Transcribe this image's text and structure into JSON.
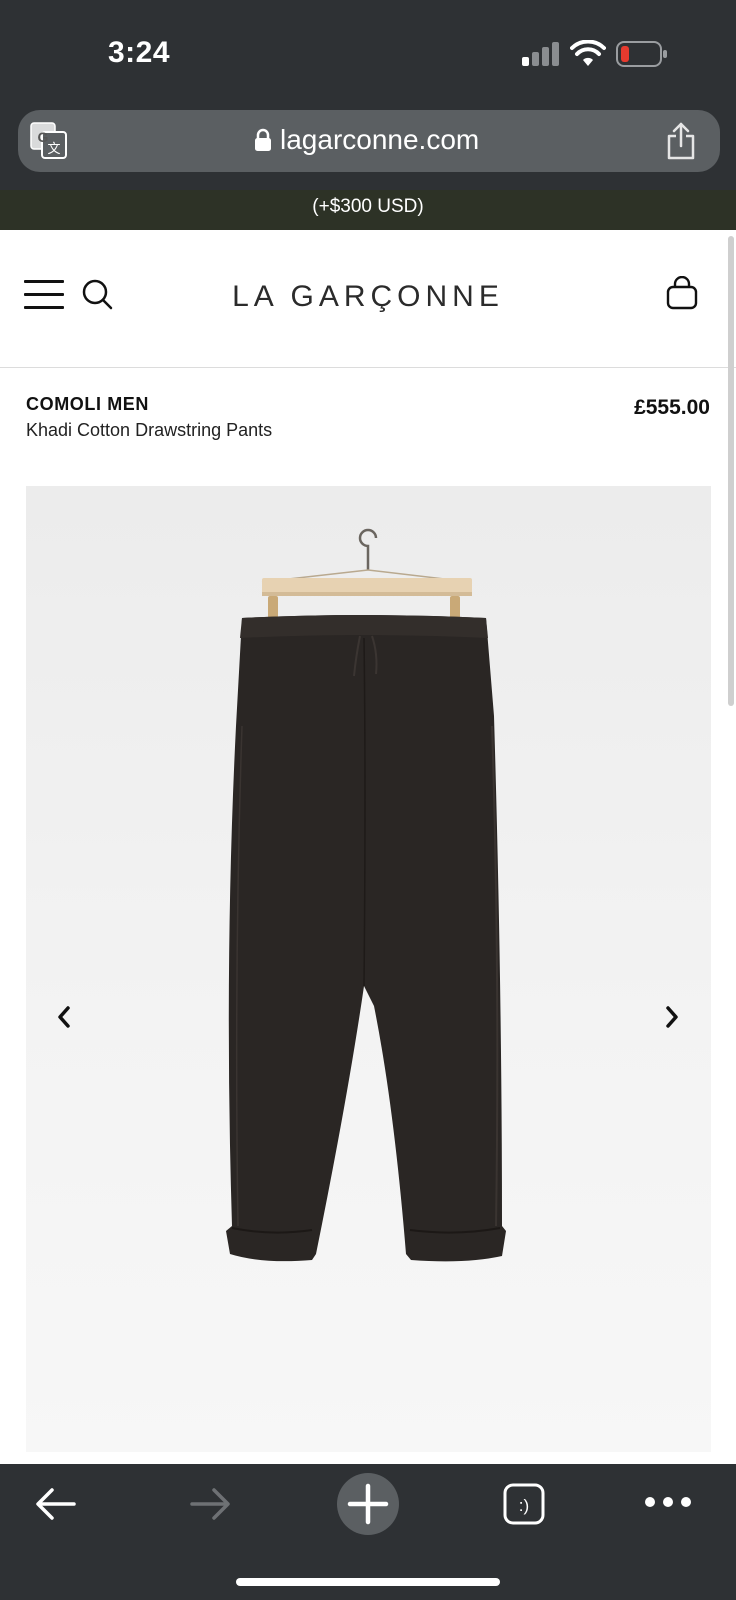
{
  "status_bar": {
    "time": "3:24"
  },
  "browser": {
    "url": "lagarconne.com"
  },
  "promo": {
    "text": "(+$300 USD)"
  },
  "site": {
    "logo": "LA GARÇONNE"
  },
  "product": {
    "brand": "COMOLI MEN",
    "name": "Khadi Cotton Drawstring Pants",
    "price": "£555.00"
  },
  "icons": {
    "translate": "translate-icon",
    "lock": "lock-icon",
    "share": "share-icon",
    "menu": "hamburger-menu-icon",
    "search": "search-icon",
    "bag": "shopping-bag-icon",
    "prev": "chevron-left-icon",
    "next": "chevron-right-icon",
    "back": "back-arrow-icon",
    "forward": "forward-arrow-icon",
    "new_tab": "plus-icon",
    "tabs": "tabs-icon",
    "more": "more-icon"
  },
  "colors": {
    "chrome": "#2e3134",
    "url_bar": "#5b5f62",
    "promo_band": "#2d3226",
    "battery_low": "#e63a2e",
    "pants": "#2a2624",
    "hanger_wood": "#e7d2b2"
  }
}
